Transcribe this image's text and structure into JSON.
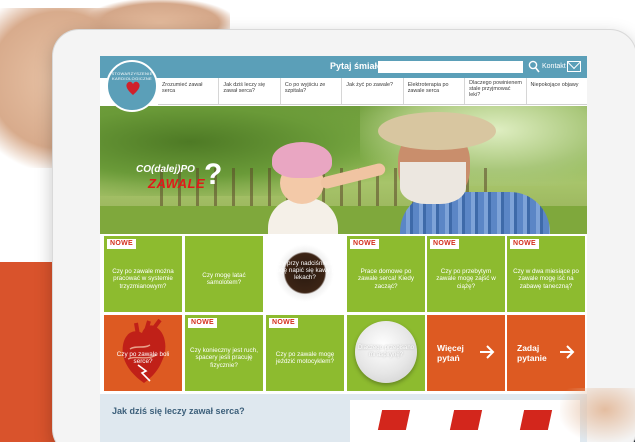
{
  "header": {
    "search_label": "Pytaj śmiało:",
    "search_value": "",
    "contact_label": "Kontakt",
    "logo_text": "STOWARZYSZENIE KARDIOLOGICZNE"
  },
  "nav": {
    "items": [
      {
        "label": "Zrozumieć zawał serca"
      },
      {
        "label": "Jak dziś leczy się zawał serca?"
      },
      {
        "label": "Co po wyjściu ze szpitala?"
      },
      {
        "label": "Jak żyć po zawale?"
      },
      {
        "label": "Elektroterapia po zawale serca"
      },
      {
        "label": "Dlaczego powinienem stale przyjmować leki?"
      },
      {
        "label": "Niepokojące objawy"
      }
    ]
  },
  "hero": {
    "title_line1": "CO(dalej)PO",
    "title_line2": "ZAWALE",
    "question_mark": "?"
  },
  "tiles": {
    "badge": "NOWE",
    "row1": [
      {
        "text": "Czy po zawale można pracować w systemie trzyzmianowym?",
        "new": true
      },
      {
        "text": "Czy mogę latać samolotem?",
        "new": false
      },
      {
        "text": "Czy przy nadciśnieniu mogę napić się kawy po lekach?",
        "new": false
      },
      {
        "text": "Prace domowe po zawale serca! Kiedy zacząć?",
        "new": true
      },
      {
        "text": "Czy po przebytym zawale mogę zajść w ciążę?",
        "new": true
      },
      {
        "text": "Czy w dwa miesiące po zawale mogę iść na zabawę taneczną?",
        "new": true
      }
    ],
    "row2": [
      {
        "text": "Czy po zawale boli serce?",
        "new": false
      },
      {
        "text": "Czy konieczny jest ruch, spacery jeśli pracuję fizycznie?",
        "new": true
      },
      {
        "text": "Czy po zawale mogę jeździć motocyklem?",
        "new": true
      },
      {
        "text": "Dlaczego przepisano mi aspirynę?",
        "new": false
      }
    ],
    "more_questions": "Więcej pytań",
    "ask_question": "Zadaj pytanie"
  },
  "bottom": {
    "title": "Jak dziś się leczy zawał serca?"
  },
  "colors": {
    "header_blue": "#5b9fb8",
    "tile_green": "#8dbb2f",
    "tile_orange": "#dd5a22",
    "badge_red": "#d42f1c"
  }
}
